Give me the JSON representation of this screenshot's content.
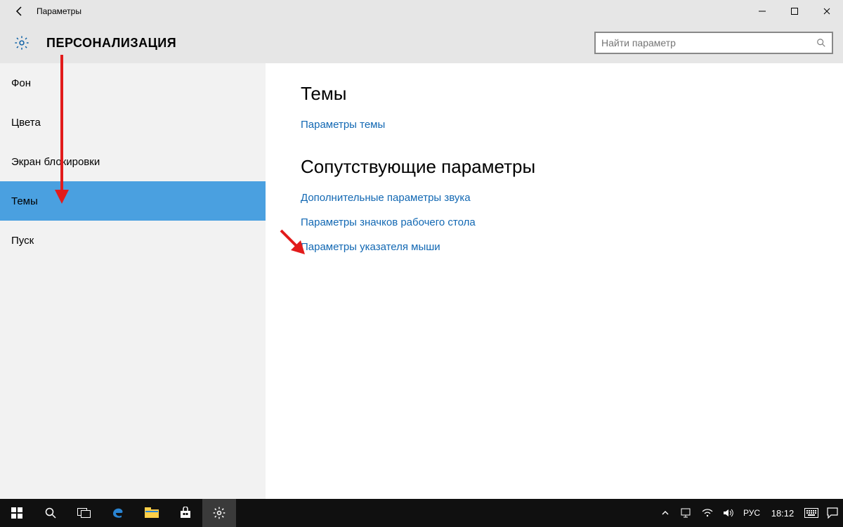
{
  "window": {
    "title": "Параметры",
    "controls": {
      "minimize": "—",
      "maximize": "▢",
      "close": "✕"
    }
  },
  "header": {
    "page_title": "ПЕРСОНАЛИЗАЦИЯ",
    "search_placeholder": "Найти параметр"
  },
  "sidebar": {
    "items": [
      {
        "label": "Фон"
      },
      {
        "label": "Цвета"
      },
      {
        "label": "Экран блокировки"
      },
      {
        "label": "Темы",
        "selected": true
      },
      {
        "label": "Пуск"
      }
    ]
  },
  "main": {
    "section1_title": "Темы",
    "section1_links": [
      "Параметры темы"
    ],
    "section2_title": "Сопутствующие параметры",
    "section2_links": [
      "Дополнительные параметры звука",
      "Параметры значков рабочего стола",
      "Параметры указателя мыши"
    ]
  },
  "taskbar": {
    "clock": "18:12"
  },
  "colors": {
    "accent": "#4aa0e0",
    "link": "#1268b3"
  }
}
